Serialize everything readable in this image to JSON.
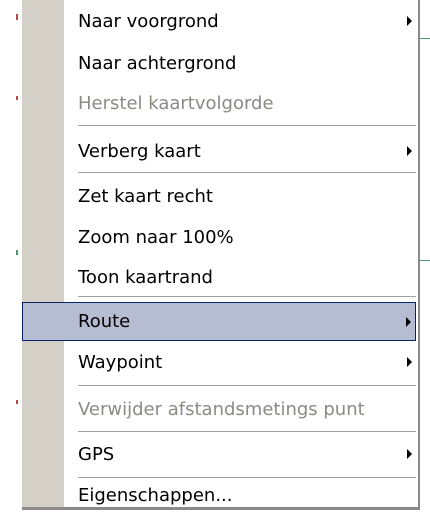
{
  "menu": {
    "items": [
      {
        "label": "Naar voorgrond",
        "submenu": true,
        "enabled": true
      },
      {
        "label": "Naar achtergrond",
        "submenu": false,
        "enabled": true
      },
      {
        "label": "Herstel kaartvolgorde",
        "submenu": false,
        "enabled": false
      },
      {
        "label": "Verberg kaart",
        "submenu": true,
        "enabled": true
      },
      {
        "label": "Zet kaart recht",
        "submenu": false,
        "enabled": true
      },
      {
        "label": "Zoom naar 100%",
        "submenu": false,
        "enabled": true
      },
      {
        "label": "Toon kaartrand",
        "submenu": false,
        "enabled": true
      },
      {
        "label": "Route",
        "submenu": true,
        "enabled": true,
        "highlighted": true
      },
      {
        "label": "Waypoint",
        "submenu": true,
        "enabled": true
      },
      {
        "label": "Verwijder afstandsmetings punt",
        "submenu": false,
        "enabled": false
      },
      {
        "label": "GPS",
        "submenu": true,
        "enabled": true
      },
      {
        "label": "Eigenschappen...",
        "submenu": false,
        "enabled": true
      }
    ]
  },
  "colors": {
    "gutter": "#d4d0c8",
    "highlight_fill": "#b6bdd2",
    "highlight_border": "#0a246a",
    "disabled_text": "#8c8a83"
  }
}
